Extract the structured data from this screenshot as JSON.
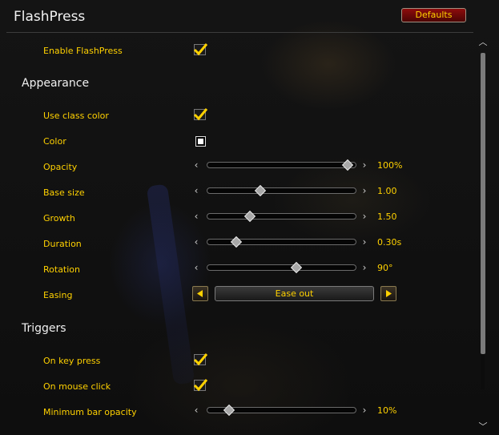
{
  "window": {
    "title": "FlashPress",
    "defaults_label": "Defaults"
  },
  "enable": {
    "label": "Enable FlashPress",
    "checked": true
  },
  "appearance": {
    "header": "Appearance",
    "use_class_color": {
      "label": "Use class color",
      "checked": true
    },
    "color": {
      "label": "Color",
      "value": "#ffffff"
    },
    "opacity": {
      "label": "Opacity",
      "value": "100%",
      "fraction": 1.0
    },
    "base_size": {
      "label": "Base size",
      "value": "1.00",
      "fraction": 0.34
    },
    "growth": {
      "label": "Growth",
      "value": "1.50",
      "fraction": 0.26
    },
    "duration": {
      "label": "Duration",
      "value": "0.30s",
      "fraction": 0.16
    },
    "rotation": {
      "label": "Rotation",
      "value": "90°",
      "fraction": 0.61
    },
    "easing": {
      "label": "Easing",
      "value": "Ease out"
    }
  },
  "triggers": {
    "header": "Triggers",
    "on_key_press": {
      "label": "On key press",
      "checked": true
    },
    "on_mouse_click": {
      "label": "On mouse click",
      "checked": true
    },
    "min_bar_opacity": {
      "label": "Minimum bar opacity",
      "value": "10%",
      "fraction": 0.1
    }
  },
  "scroll": {
    "position": 0.0
  },
  "colors": {
    "accent": "#ffd100",
    "defaults_button": "#7a0a0a"
  }
}
